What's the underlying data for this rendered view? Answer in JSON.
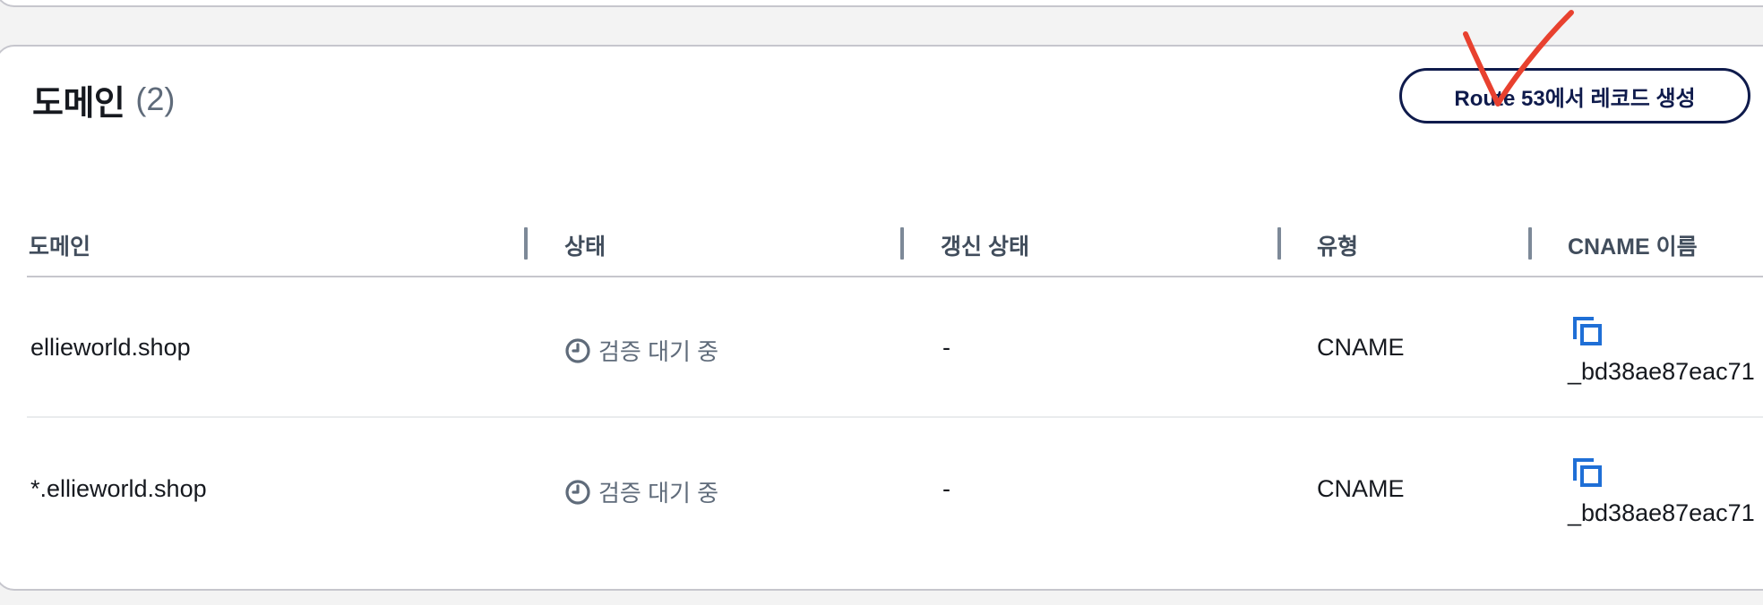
{
  "header": {
    "title": "도메인",
    "count": "(2)",
    "action_button": "Route 53에서 레코드 생성"
  },
  "table": {
    "columns": [
      "도메인",
      "상태",
      "갱신 상태",
      "유형",
      "CNAME 이름"
    ],
    "rows": [
      {
        "domain": "ellieworld.shop",
        "status": "검증 대기 중",
        "renewal_status": "-",
        "type": "CNAME",
        "cname_name": "_bd38ae87eac71"
      },
      {
        "domain": "*.ellieworld.shop",
        "status": "검증 대기 중",
        "renewal_status": "-",
        "type": "CNAME",
        "cname_name": "_bd38ae87eac71"
      }
    ]
  },
  "icons": {
    "status": "clock-icon",
    "copy": "copy-icon"
  },
  "colors": {
    "primary_button_border": "#0f1b4c",
    "annotation_mark": "#e8412f",
    "copy_icon": "#1f6fd6",
    "status_text": "#5f6b7a"
  }
}
